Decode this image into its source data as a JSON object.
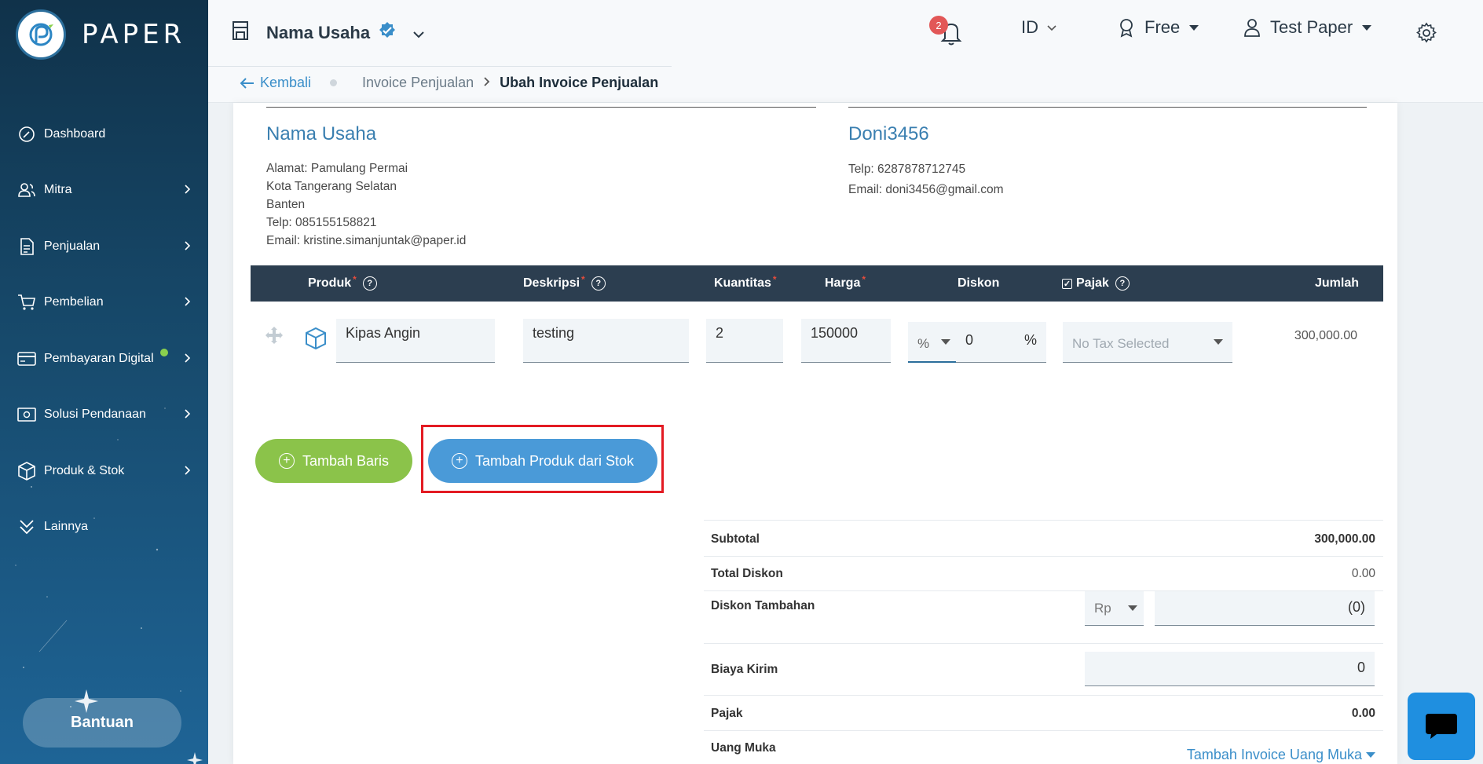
{
  "brand": {
    "name": "PAPER"
  },
  "sidebar": {
    "items": [
      {
        "label": "Dashboard",
        "icon": "dashboard-icon",
        "has_children": false
      },
      {
        "label": "Mitra",
        "icon": "users-icon",
        "has_children": true
      },
      {
        "label": "Penjualan",
        "icon": "document-icon",
        "has_children": true
      },
      {
        "label": "Pembelian",
        "icon": "cart-icon",
        "has_children": true
      },
      {
        "label": "Pembayaran Digital",
        "icon": "card-icon",
        "has_children": true,
        "dot": true
      },
      {
        "label": "Solusi Pendanaan",
        "icon": "money-icon",
        "has_children": true
      },
      {
        "label": "Produk & Stok",
        "icon": "box-icon",
        "has_children": true
      },
      {
        "label": "Lainnya",
        "icon": "chevrons-down-icon",
        "has_children": false
      }
    ],
    "help_label": "Bantuan"
  },
  "header": {
    "business_name": "Nama Usaha",
    "notification_count": "2",
    "language": "ID",
    "plan": "Free",
    "user": "Test Paper",
    "breadcrumb": {
      "back": "Kembali",
      "parent": "Invoice Penjualan",
      "current": "Ubah Invoice Penjualan"
    }
  },
  "seller": {
    "name": "Nama Usaha",
    "lines": [
      "Alamat: Pamulang Permai",
      "Kota Tangerang Selatan",
      "Banten",
      "Telp: 085155158821",
      "Email: kristine.simanjuntak@paper.id"
    ]
  },
  "buyer": {
    "name": "Doni3456",
    "lines": [
      "Telp: 6287878712745",
      "Email: doni3456@gmail.com"
    ]
  },
  "table": {
    "headers": {
      "product": "Produk",
      "description": "Deskripsi",
      "quantity": "Kuantitas",
      "price": "Harga",
      "discount": "Diskon",
      "tax": "Pajak",
      "total": "Jumlah"
    },
    "rows": [
      {
        "product": "Kipas Angin",
        "description": "testing",
        "quantity": "2",
        "price": "150000",
        "discount_type": "%",
        "discount_value": "0",
        "discount_unit": "%",
        "tax_placeholder": "No Tax Selected",
        "total": "300,000.00"
      }
    ]
  },
  "buttons": {
    "add_row": "Tambah Baris",
    "add_from_stock": "Tambah Produk dari Stok"
  },
  "summary": {
    "subtotal_label": "Subtotal",
    "subtotal": "300,000.00",
    "total_discount_label": "Total Diskon",
    "total_discount": "0.00",
    "extra_discount_label": "Diskon Tambahan",
    "extra_discount_currency": "Rp",
    "extra_discount_value": "(0)",
    "shipping_label": "Biaya Kirim",
    "shipping_value": "0",
    "tax_label": "Pajak",
    "tax": "0.00",
    "down_payment_label": "Uang Muka",
    "down_payment_link": "Tambah Invoice Uang Muka"
  }
}
